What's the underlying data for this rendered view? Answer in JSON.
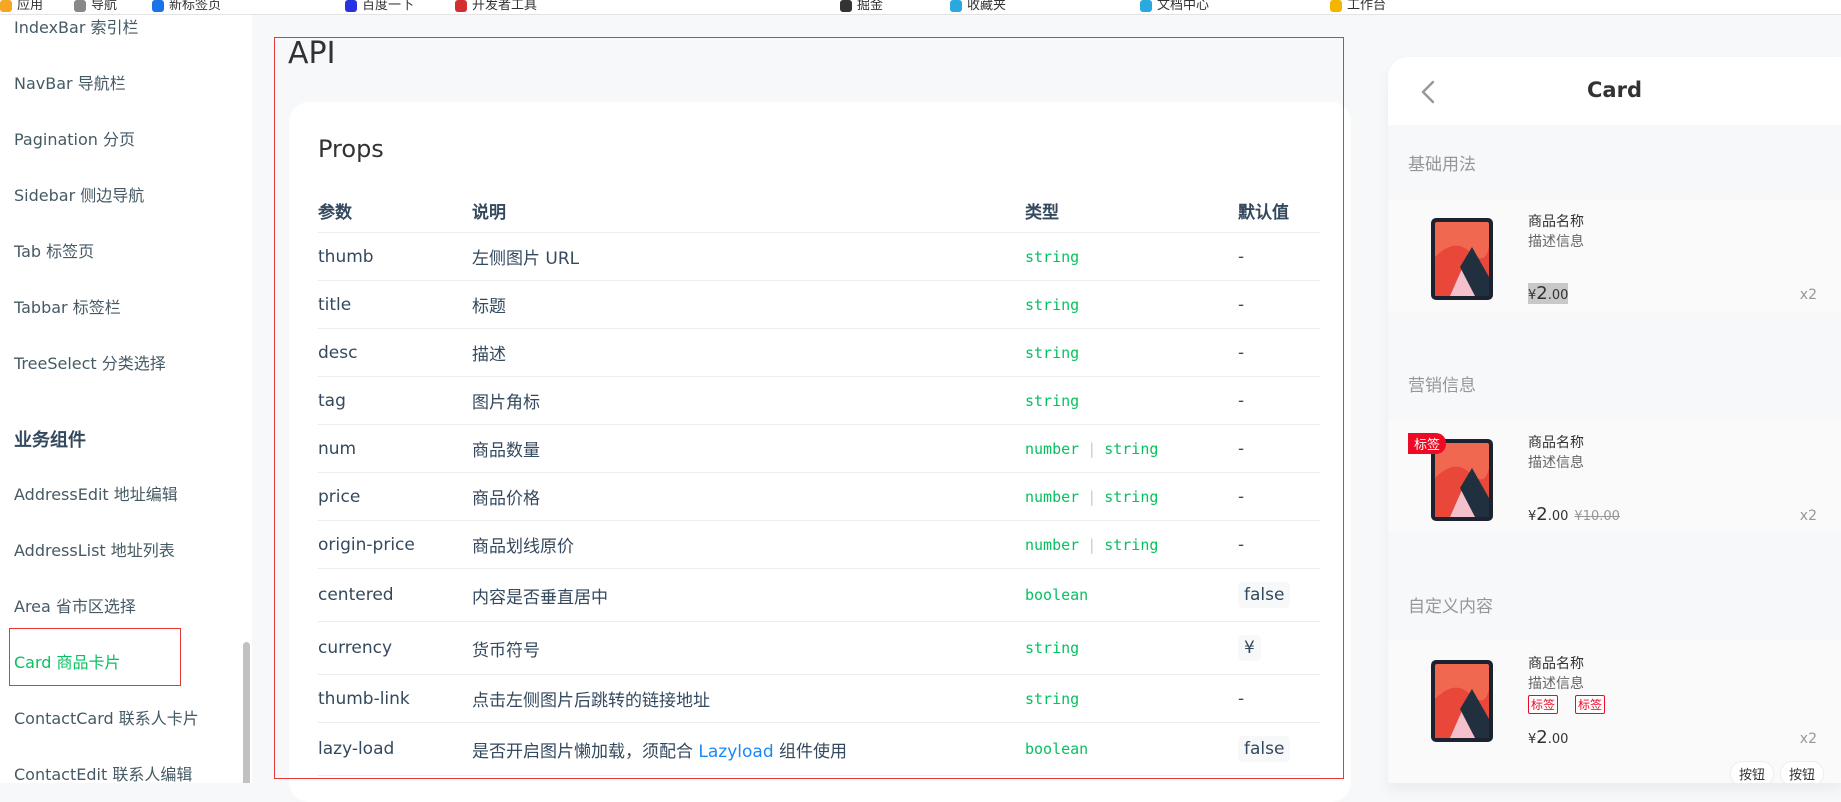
{
  "browser": {
    "bookmarks": [
      "应用",
      "导航",
      "新标签页",
      "百度一下",
      "开发者工具",
      "掘金",
      "收藏夹",
      "文档中心",
      "工作台"
    ]
  },
  "sidebar": {
    "items_top": [
      {
        "label": "IndexBar 索引栏"
      },
      {
        "label": "NavBar 导航栏"
      },
      {
        "label": "Pagination 分页"
      },
      {
        "label": "Sidebar 侧边导航"
      },
      {
        "label": "Tab 标签页"
      },
      {
        "label": "Tabbar 标签栏"
      },
      {
        "label": "TreeSelect 分类选择"
      }
    ],
    "group_label": "业务组件",
    "items_business": [
      {
        "label": "AddressEdit 地址编辑"
      },
      {
        "label": "AddressList 地址列表"
      },
      {
        "label": "Area 省市区选择"
      },
      {
        "label": "Card 商品卡片"
      },
      {
        "label": "ContactCard 联系人卡片"
      },
      {
        "label": "ContactEdit 联系人编辑"
      }
    ]
  },
  "doc": {
    "section_title": "API",
    "props_title": "Props",
    "headers": {
      "param": "参数",
      "desc": "说明",
      "type": "类型",
      "default": "默认值"
    },
    "rows": [
      {
        "param": "thumb",
        "desc": "左侧图片 URL",
        "types": [
          "string"
        ],
        "default": "-"
      },
      {
        "param": "title",
        "desc": "标题",
        "types": [
          "string"
        ],
        "default": "-"
      },
      {
        "param": "desc",
        "desc": "描述",
        "types": [
          "string"
        ],
        "default": "-"
      },
      {
        "param": "tag",
        "desc": "图片角标",
        "types": [
          "string"
        ],
        "default": "-"
      },
      {
        "param": "num",
        "desc": "商品数量",
        "types": [
          "number",
          "string"
        ],
        "default": "-"
      },
      {
        "param": "price",
        "desc": "商品价格",
        "types": [
          "number",
          "string"
        ],
        "default": "-"
      },
      {
        "param": "origin-price",
        "desc": "商品划线原价",
        "types": [
          "number",
          "string"
        ],
        "default": "-"
      },
      {
        "param": "centered",
        "desc": "内容是否垂直居中",
        "types": [
          "boolean"
        ],
        "default": "false",
        "default_code": true
      },
      {
        "param": "currency",
        "desc": "货币符号",
        "types": [
          "string"
        ],
        "default": "¥",
        "default_code": true
      },
      {
        "param": "thumb-link",
        "desc": "点击左侧图片后跳转的链接地址",
        "types": [
          "string"
        ],
        "default": "-"
      },
      {
        "param": "lazy-load",
        "desc": "是否开启图片懒加载，须配合",
        "desc_link": "Lazyload",
        "desc_after": " 组件使用",
        "types": [
          "boolean"
        ],
        "default": "false",
        "default_code": true
      }
    ]
  },
  "phone": {
    "title": "Card",
    "demos": [
      {
        "title": "基础用法",
        "goods_title": "商品名称",
        "goods_desc": "描述信息",
        "currency": "¥",
        "price_int": "2",
        "price_dec": ".00",
        "num": "x2"
      },
      {
        "title": "营销信息",
        "tag": "标签",
        "goods_title": "商品名称",
        "goods_desc": "描述信息",
        "currency": "¥",
        "price_int": "2",
        "price_dec": ".00",
        "origin_price": "¥10.00",
        "num": "x2"
      },
      {
        "title": "自定义内容",
        "goods_title": "商品名称",
        "goods_desc": "描述信息",
        "tags": [
          "标签",
          "标签"
        ],
        "currency": "¥",
        "price_int": "2",
        "price_dec": ".00",
        "num": "x2",
        "buttons": [
          "按钮",
          "按钮"
        ]
      }
    ]
  }
}
